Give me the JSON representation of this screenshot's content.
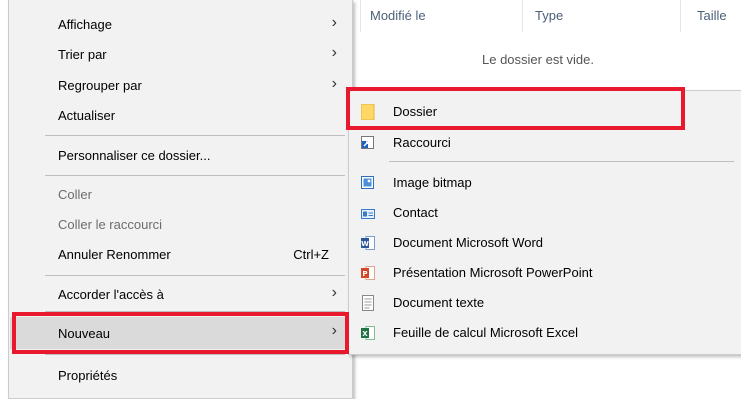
{
  "explorer": {
    "columns": [
      "Modifié le",
      "Type",
      "Taille"
    ],
    "empty_message": "Le dossier est vide."
  },
  "context_menu": {
    "items": [
      {
        "label": "Affichage",
        "submenu": true
      },
      {
        "label": "Trier par",
        "submenu": true
      },
      {
        "label": "Regrouper par",
        "submenu": true
      },
      {
        "label": "Actualiser"
      },
      {
        "label": "Personnaliser ce dossier..."
      },
      {
        "label": "Coller",
        "disabled": true
      },
      {
        "label": "Coller le raccourci",
        "disabled": true
      },
      {
        "label": "Annuler Renommer",
        "shortcut": "Ctrl+Z"
      },
      {
        "label": "Accorder l'accès à",
        "submenu": true
      },
      {
        "label": "Nouveau",
        "submenu": true,
        "highlighted": true
      },
      {
        "label": "Propriétés"
      }
    ]
  },
  "new_submenu": {
    "items": [
      {
        "label": "Dossier",
        "icon": "folder-icon"
      },
      {
        "label": "Raccourci",
        "icon": "shortcut-icon"
      },
      {
        "label": "Image bitmap",
        "icon": "bitmap-icon"
      },
      {
        "label": "Contact",
        "icon": "contact-icon"
      },
      {
        "label": "Document Microsoft Word",
        "icon": "word-icon"
      },
      {
        "label": "Présentation Microsoft PowerPoint",
        "icon": "powerpoint-icon"
      },
      {
        "label": "Document texte",
        "icon": "text-document-icon"
      },
      {
        "label": "Feuille de calcul Microsoft Excel",
        "icon": "excel-icon"
      }
    ]
  },
  "colors": {
    "annotation_red": "#e8192c",
    "menu_background": "#f2f2f2",
    "hover_background": "#dadada"
  },
  "glyphs": {
    "chevron": "›"
  }
}
